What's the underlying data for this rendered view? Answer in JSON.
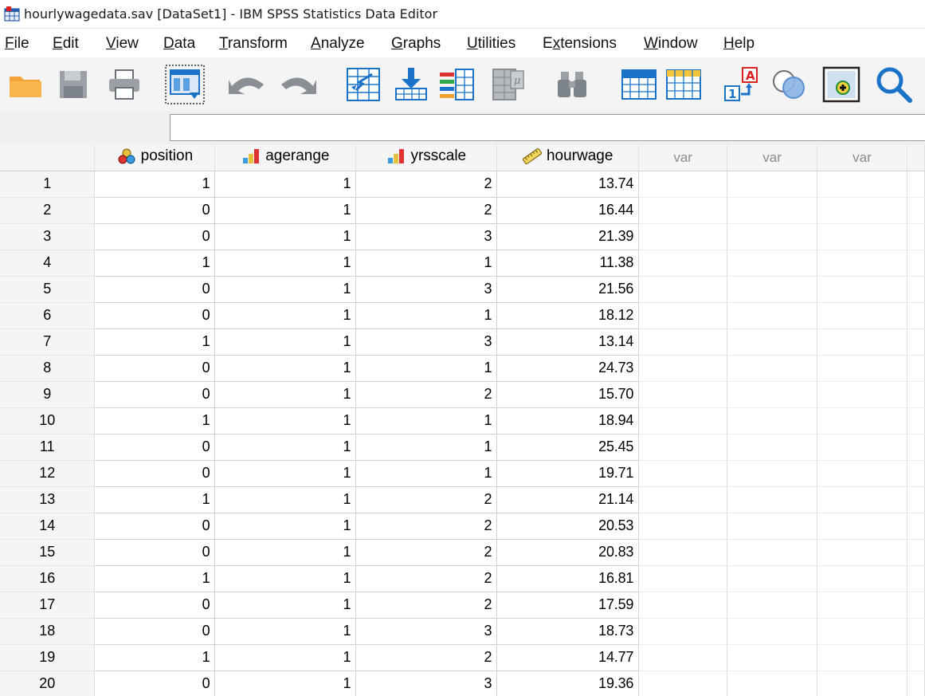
{
  "window": {
    "title": "hourlywagedata.sav [DataSet1] - IBM SPSS Statistics Data Editor"
  },
  "menu": {
    "items": [
      {
        "pre": "",
        "key": "F",
        "post": "ile"
      },
      {
        "pre": "",
        "key": "E",
        "post": "dit"
      },
      {
        "pre": "",
        "key": "V",
        "post": "iew"
      },
      {
        "pre": "",
        "key": "D",
        "post": "ata"
      },
      {
        "pre": "",
        "key": "T",
        "post": "ransform"
      },
      {
        "pre": "",
        "key": "A",
        "post": "nalyze"
      },
      {
        "pre": "",
        "key": "G",
        "post": "raphs"
      },
      {
        "pre": "",
        "key": "U",
        "post": "tilities"
      },
      {
        "pre": "E",
        "key": "x",
        "post": "tensions"
      },
      {
        "pre": "",
        "key": "W",
        "post": "indow"
      },
      {
        "pre": "",
        "key": "H",
        "post": "elp"
      }
    ]
  },
  "toolbar": {
    "icons": [
      "open-folder-icon",
      "save-icon",
      "print-icon",
      "recall-dialog-icon",
      "undo-icon",
      "redo-icon",
      "goto-case-icon",
      "goto-variable-icon",
      "variables-icon",
      "run-descriptives-icon",
      "find-icon",
      "insert-cases-icon",
      "insert-variable-icon",
      "value-labels-icon",
      "use-variable-sets-icon",
      "show-all-variables-icon",
      "search-icon"
    ]
  },
  "editor": {
    "value": ""
  },
  "grid": {
    "columns": [
      {
        "name": "position",
        "icon": "nominal-icon"
      },
      {
        "name": "agerange",
        "icon": "ordinal-icon"
      },
      {
        "name": "yrsscale",
        "icon": "ordinal-icon"
      },
      {
        "name": "hourwage",
        "icon": "scale-icon"
      },
      {
        "name": "var",
        "icon": ""
      },
      {
        "name": "var",
        "icon": ""
      },
      {
        "name": "var",
        "icon": ""
      }
    ],
    "rows": [
      {
        "n": "1",
        "position": "1",
        "agerange": "1",
        "yrsscale": "2",
        "hourwage": "13.74"
      },
      {
        "n": "2",
        "position": "0",
        "agerange": "1",
        "yrsscale": "2",
        "hourwage": "16.44"
      },
      {
        "n": "3",
        "position": "0",
        "agerange": "1",
        "yrsscale": "3",
        "hourwage": "21.39"
      },
      {
        "n": "4",
        "position": "1",
        "agerange": "1",
        "yrsscale": "1",
        "hourwage": "11.38"
      },
      {
        "n": "5",
        "position": "0",
        "agerange": "1",
        "yrsscale": "3",
        "hourwage": "21.56"
      },
      {
        "n": "6",
        "position": "0",
        "agerange": "1",
        "yrsscale": "1",
        "hourwage": "18.12"
      },
      {
        "n": "7",
        "position": "1",
        "agerange": "1",
        "yrsscale": "3",
        "hourwage": "13.14"
      },
      {
        "n": "8",
        "position": "0",
        "agerange": "1",
        "yrsscale": "1",
        "hourwage": "24.73"
      },
      {
        "n": "9",
        "position": "0",
        "agerange": "1",
        "yrsscale": "2",
        "hourwage": "15.70"
      },
      {
        "n": "10",
        "position": "1",
        "agerange": "1",
        "yrsscale": "1",
        "hourwage": "18.94"
      },
      {
        "n": "11",
        "position": "0",
        "agerange": "1",
        "yrsscale": "1",
        "hourwage": "25.45"
      },
      {
        "n": "12",
        "position": "0",
        "agerange": "1",
        "yrsscale": "1",
        "hourwage": "19.71"
      },
      {
        "n": "13",
        "position": "1",
        "agerange": "1",
        "yrsscale": "2",
        "hourwage": "21.14"
      },
      {
        "n": "14",
        "position": "0",
        "agerange": "1",
        "yrsscale": "2",
        "hourwage": "20.53"
      },
      {
        "n": "15",
        "position": "0",
        "agerange": "1",
        "yrsscale": "2",
        "hourwage": "20.83"
      },
      {
        "n": "16",
        "position": "1",
        "agerange": "1",
        "yrsscale": "2",
        "hourwage": "16.81"
      },
      {
        "n": "17",
        "position": "0",
        "agerange": "1",
        "yrsscale": "2",
        "hourwage": "17.59"
      },
      {
        "n": "18",
        "position": "0",
        "agerange": "1",
        "yrsscale": "3",
        "hourwage": "18.73"
      },
      {
        "n": "19",
        "position": "1",
        "agerange": "1",
        "yrsscale": "2",
        "hourwage": "14.77"
      },
      {
        "n": "20",
        "position": "0",
        "agerange": "1",
        "yrsscale": "3",
        "hourwage": "19.36"
      }
    ]
  },
  "colors": {
    "accent_blue": "#1a73c9",
    "folder_orange": "#f0a030",
    "grid_header": "#f5f5f5"
  }
}
